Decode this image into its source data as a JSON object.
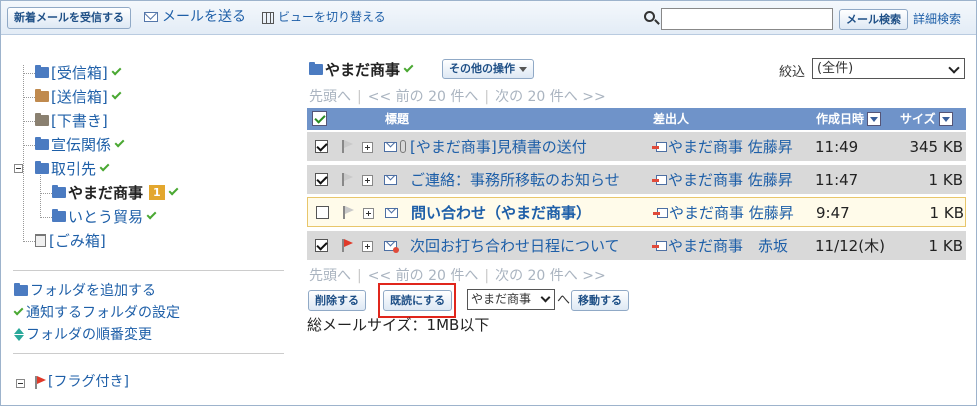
{
  "toolbar": {
    "receive_label": "新着メールを受信する",
    "compose_label": "メールを送る",
    "view_label": "ビューを切り替える",
    "search_placeholder": "",
    "search_value": "",
    "search_button_label": "メール検索",
    "advanced_search_label": "詳細検索"
  },
  "sidebar": {
    "folders": [
      {
        "label": "[受信箱]",
        "icon": "folder-icon",
        "checked": true
      },
      {
        "label": "[送信箱]",
        "icon": "sent-folder-icon",
        "checked": true
      },
      {
        "label": "[下書き]",
        "icon": "draft-folder-icon",
        "checked": false
      },
      {
        "label": "宣伝関係",
        "icon": "folder-icon",
        "checked": true
      },
      {
        "label": "取引先",
        "icon": "folder-icon",
        "checked": true
      },
      {
        "label": "やまだ商事",
        "icon": "folder-icon",
        "checked": true,
        "badge": "1",
        "current": true
      },
      {
        "label": "いとう貿易",
        "icon": "folder-icon",
        "checked": true
      },
      {
        "label": "[ごみ箱]",
        "icon": "trash-icon",
        "checked": false
      }
    ],
    "actions": {
      "add_folder": "フォルダを追加する",
      "notify_settings": "通知するフォルダの設定",
      "reorder": "フォルダの順番変更"
    },
    "flagged_label": "[フラグ付き]"
  },
  "main": {
    "folder_title": "やまだ商事",
    "other_ops_label": "その他の操作",
    "filter_label": "絞込",
    "filter_value": "(全件)",
    "pager": {
      "first": "先頭へ",
      "prev": "<< 前の 20 件へ",
      "next": "次の 20 件へ >>"
    },
    "columns": {
      "subject": "標題",
      "sender": "差出人",
      "date": "作成日時",
      "size": "サイズ"
    },
    "messages": [
      {
        "checked": true,
        "flag": "gray",
        "attachment": true,
        "subject": "[やまだ商事]見積書の送付",
        "sender": "やまだ商事 佐藤昇",
        "date": "11:49",
        "size": "345 KB",
        "unread": false
      },
      {
        "checked": true,
        "flag": "gray",
        "attachment": false,
        "subject": "ご連絡：事務所移転のお知らせ",
        "sender": "やまだ商事 佐藤昇",
        "date": "11:47",
        "size": "1 KB",
        "unread": false
      },
      {
        "checked": false,
        "flag": "gray",
        "attachment": false,
        "subject": "問い合わせ（やまだ商事）",
        "sender": "やまだ商事 佐藤昇",
        "date": "9:47",
        "size": "1 KB",
        "unread": true
      },
      {
        "checked": true,
        "flag": "red",
        "attachment": false,
        "subject": "次回お打ち合わせ日程について",
        "sender": "やまだ商事　赤坂",
        "date": "11/12(木)",
        "size": "1 KB",
        "unread": false
      }
    ],
    "delete_label": "削除する",
    "mark_read_label": "既読にする",
    "move_target": "やまだ商事",
    "move_to_label": "へ",
    "move_label": "移動する",
    "total_size_label": "総メールサイズ：1MB以下"
  },
  "colors": {
    "header_bg": "#6f93c9",
    "link": "#1e5fa8",
    "check": "#4aa832",
    "highlight": "#e0261c",
    "badge": "#e3a72e"
  }
}
